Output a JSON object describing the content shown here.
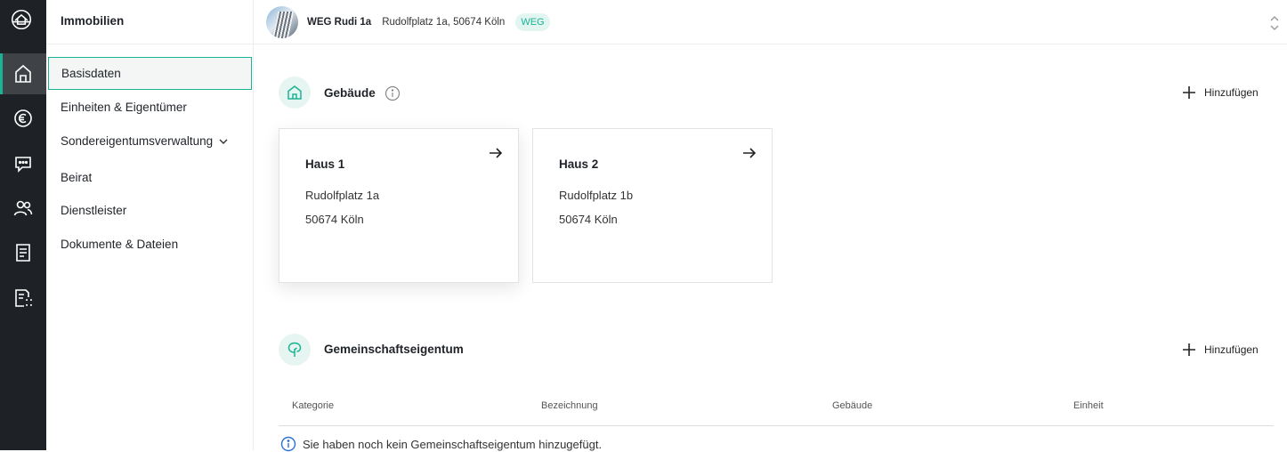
{
  "colors": {
    "accent": "#1ab394",
    "rail": "#1e2226"
  },
  "rail": {
    "logo_icon": "house-logo-icon",
    "items": [
      {
        "icon": "home-icon",
        "active": true
      },
      {
        "icon": "euro-icon",
        "active": false
      },
      {
        "icon": "chat-icon",
        "active": false
      },
      {
        "icon": "people-icon",
        "active": false
      },
      {
        "icon": "document-list-icon",
        "active": false
      },
      {
        "icon": "document-scan-icon",
        "active": false
      }
    ]
  },
  "subnav": {
    "title": "Immobilien",
    "items": [
      {
        "label": "Basisdaten",
        "active": true
      },
      {
        "label": "Einheiten & Eigentümer"
      },
      {
        "label": "Sondereigentumsverwaltung",
        "has_chevron": true
      },
      {
        "label": "Beirat"
      },
      {
        "label": "Dienstleister"
      },
      {
        "label": "Dokumente & Dateien"
      }
    ]
  },
  "header": {
    "property_name": "WEG Rudi 1a",
    "address": "Rudolfplatz 1a, 50674 Köln",
    "badge": "WEG"
  },
  "buildings": {
    "title": "Gebäude",
    "add_label": "Hinzufügen",
    "cards": [
      {
        "title": "Haus 1",
        "street": "Rudolfplatz 1a",
        "city": "50674 Köln"
      },
      {
        "title": "Haus 2",
        "street": "Rudolfplatz 1b",
        "city": "50674 Köln"
      }
    ]
  },
  "common_property": {
    "title": "Gemeinschaftseigentum",
    "add_label": "Hinzufügen",
    "columns": [
      "Kategorie",
      "Bezeichnung",
      "Gebäude",
      "Einheit"
    ],
    "empty_message": "Sie haben noch kein Gemeinschaftseigentum hinzugefügt."
  }
}
